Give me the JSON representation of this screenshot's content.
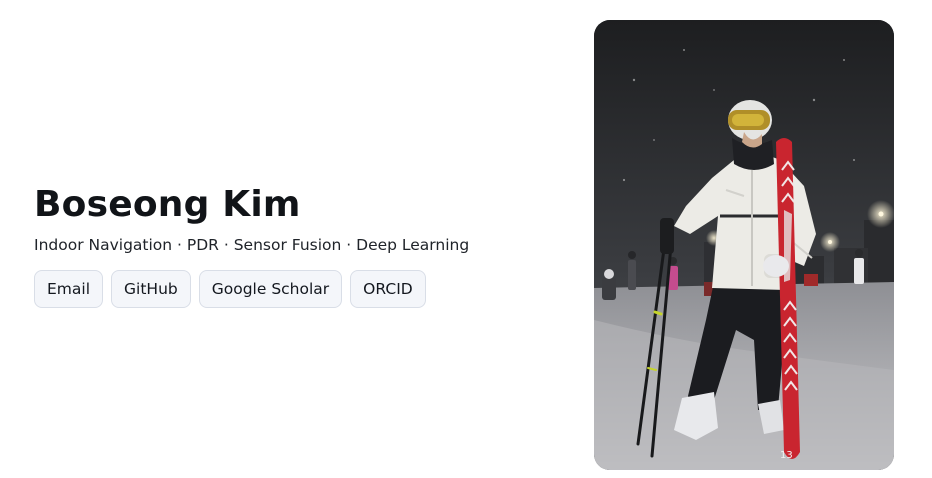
{
  "profile": {
    "name": "Boseong Kim",
    "tagline": "Indoor Navigation · PDR · Sensor Fusion · Deep Learning"
  },
  "links": {
    "email": "Email",
    "github": "GitHub",
    "scholar": "Google Scholar",
    "orcid": "ORCID"
  },
  "photo": {
    "ski_number": "13"
  },
  "colors": {
    "background": "#ffffff",
    "text": "#111418",
    "chip_background": "#f4f6fa",
    "chip_border": "#d9dee7",
    "ski_red": "#c9252f"
  }
}
